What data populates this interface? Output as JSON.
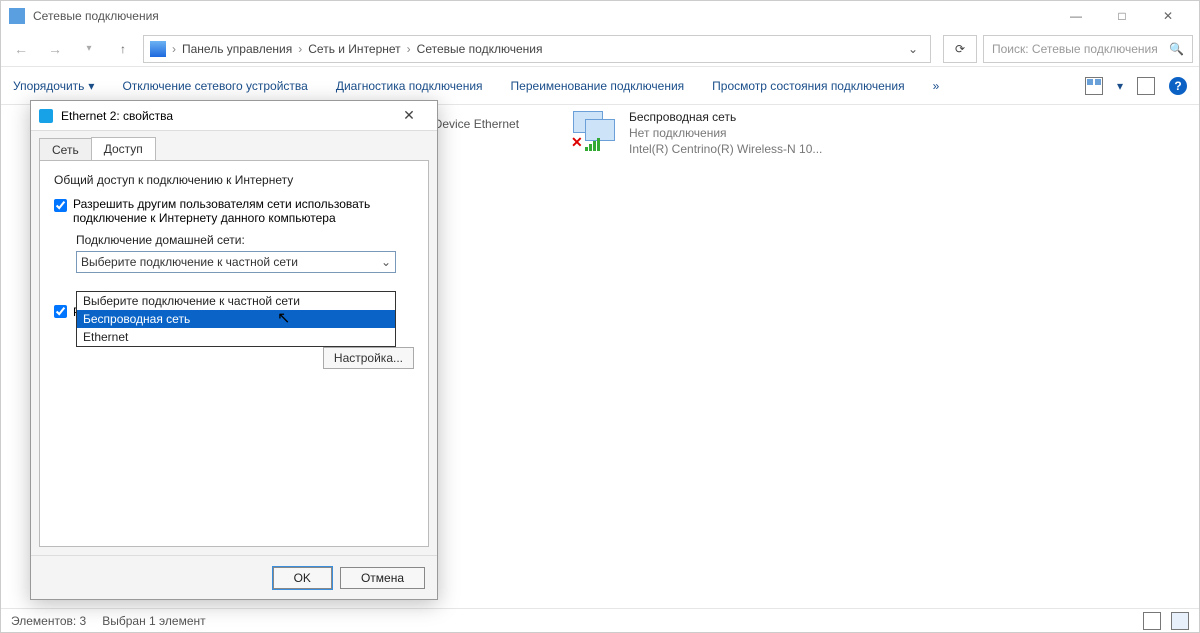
{
  "window": {
    "title": "Сетевые подключения"
  },
  "breadcrumbs": {
    "root": "Панель управления",
    "mid": "Сеть и Интернет",
    "leaf": "Сетевые подключения"
  },
  "search": {
    "placeholder": "Поиск: Сетевые подключения"
  },
  "toolbar": {
    "organize": "Упорядочить",
    "disable": "Отключение сетевого устройства",
    "diagnose": "Диагностика подключения",
    "rename": "Переименование подключения",
    "view_status": "Просмотр состояния подключения"
  },
  "partial_label": "le Device Ethernet",
  "wifi_item": {
    "name": "Беспроводная сеть",
    "status": "Нет подключения",
    "adapter": "Intel(R) Centrino(R) Wireless-N 10..."
  },
  "dialog": {
    "title": "Ethernet 2: свойства",
    "tab_network": "Сеть",
    "tab_access": "Доступ",
    "group": "Общий доступ к подключению к Интернету",
    "chk1": "Разрешить другим пользователям сети использовать подключение к Интернету данного компьютера",
    "home_label": "Подключение домашней сети:",
    "combo_value": "Выберите подключение к частной сети",
    "options": {
      "opt0": "Выберите подключение к частной сети",
      "opt1": "Беспроводная сеть",
      "opt2": "Ethernet"
    },
    "chk2_partial": "Р",
    "settings": "Настройка...",
    "ok": "OK",
    "cancel": "Отмена"
  },
  "status": {
    "count": "Элементов: 3",
    "selected": "Выбран 1 элемент"
  }
}
